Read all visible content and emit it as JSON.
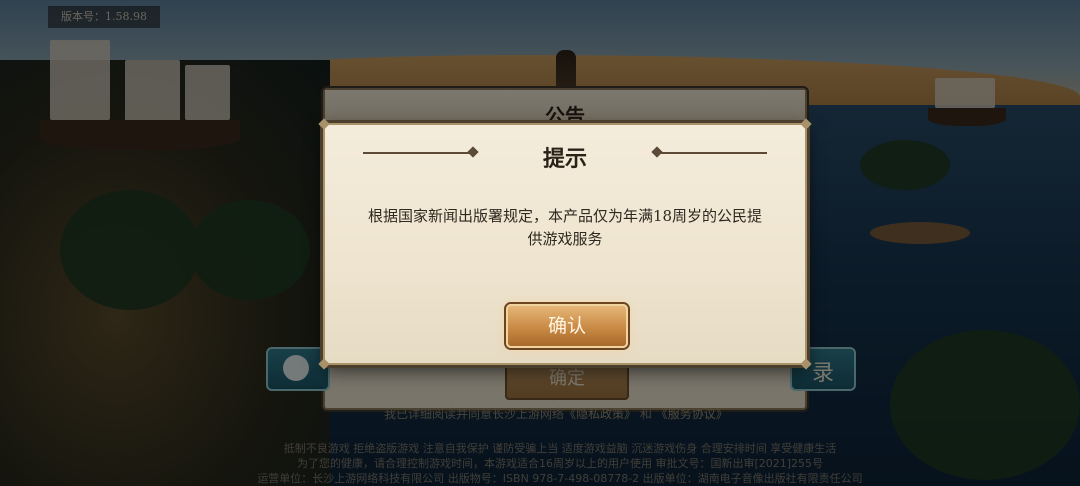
{
  "version_label": "版本号：1.58.98",
  "notice": {
    "title": "公告",
    "behind_button": "确定"
  },
  "dialog": {
    "title": "提示",
    "message": "根据国家新闻出版署规定，本产品仅为年满18周岁的公民提供游戏服务",
    "confirm_button": "确认"
  },
  "login": {
    "button_label": "录"
  },
  "agreement": {
    "prefix": "我已详细阅读并同意长沙上游网络",
    "privacy_link": "《隐私政策》",
    "and": "和",
    "service_link": "《服务协议》"
  },
  "footer": {
    "line1": "抵制不良游戏 拒绝盗版游戏 注意自我保护 谨防受骗上当 适度游戏益脑 沉迷游戏伤身 合理安排时间 享受健康生活",
    "line2": "为了您的健康，请合理控制游戏时间，本游戏适合16周岁以上的用户使用 审批文号：国新出审[2021]255号",
    "line3": "运营单位：长沙上游网络科技有限公司 出版物号：ISBN 978-7-498-08778-2 出版单位：湖南电子音像出版社有限责任公司"
  }
}
